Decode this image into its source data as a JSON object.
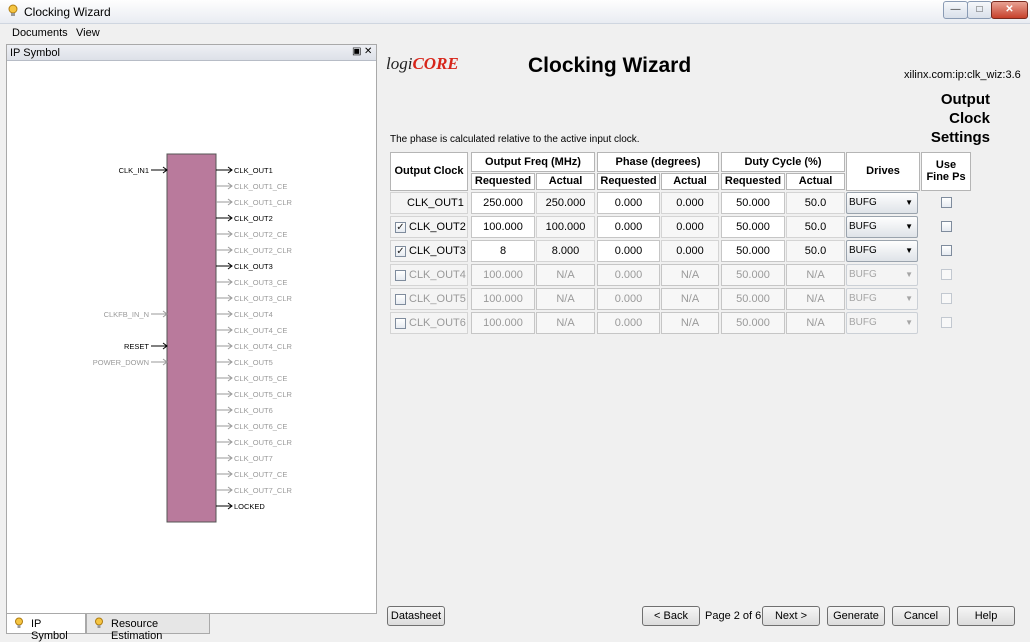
{
  "window": {
    "title": "Clocking Wizard",
    "controls": {
      "minimize": "—",
      "maximize": "□",
      "close": "✕"
    }
  },
  "menu": {
    "items": [
      "Documents",
      "View"
    ]
  },
  "left_panel": {
    "title": "IP Symbol",
    "header_icons": {
      "float": "▣",
      "close": "✕"
    },
    "symbol": {
      "block_color": "#b97a9c",
      "inputs": [
        {
          "label": "CLK_IN1",
          "active": true
        },
        {
          "label": "CLKFB_IN_N",
          "active": false
        },
        {
          "label": "RESET",
          "active": true
        },
        {
          "label": "POWER_DOWN",
          "active": false
        }
      ],
      "outputs": [
        {
          "label": "CLK_OUT1",
          "active": true
        },
        {
          "label": "CLK_OUT1_CE",
          "active": false
        },
        {
          "label": "CLK_OUT1_CLR",
          "active": false
        },
        {
          "label": "CLK_OUT2",
          "active": true
        },
        {
          "label": "CLK_OUT2_CE",
          "active": false
        },
        {
          "label": "CLK_OUT2_CLR",
          "active": false
        },
        {
          "label": "CLK_OUT3",
          "active": true
        },
        {
          "label": "CLK_OUT3_CE",
          "active": false
        },
        {
          "label": "CLK_OUT3_CLR",
          "active": false
        },
        {
          "label": "CLK_OUT4",
          "active": false
        },
        {
          "label": "CLK_OUT4_CE",
          "active": false
        },
        {
          "label": "CLK_OUT4_CLR",
          "active": false
        },
        {
          "label": "CLK_OUT5",
          "active": false
        },
        {
          "label": "CLK_OUT5_CE",
          "active": false
        },
        {
          "label": "CLK_OUT5_CLR",
          "active": false
        },
        {
          "label": "CLK_OUT6",
          "active": false
        },
        {
          "label": "CLK_OUT6_CE",
          "active": false
        },
        {
          "label": "CLK_OUT6_CLR",
          "active": false
        },
        {
          "label": "CLK_OUT7",
          "active": false
        },
        {
          "label": "CLK_OUT7_CE",
          "active": false
        },
        {
          "label": "CLK_OUT7_CLR",
          "active": false
        },
        {
          "label": "LOCKED",
          "active": true
        }
      ]
    },
    "tabs": [
      {
        "label": "IP Symbol",
        "active": true
      },
      {
        "label": "Resource Estimation",
        "active": false
      }
    ]
  },
  "main": {
    "logo": {
      "part1": "logi",
      "part2": "CORE"
    },
    "title": "Clocking Wizard",
    "ip_name": "xilinx.com:ip:clk_wiz:3.6",
    "page_heading": [
      "Output",
      "Clock",
      "Settings"
    ],
    "phase_note": "The phase is calculated relative to the active input clock.",
    "table": {
      "headers": {
        "output_clock": "Output Clock",
        "output_freq": "Output Freq (MHz)",
        "phase": "Phase (degrees)",
        "duty_cycle": "Duty Cycle (%)",
        "drives": "Drives",
        "use_fine_ps": [
          "Use",
          "Fine Ps"
        ],
        "requested": "Requested",
        "actual": "Actual"
      },
      "rows": [
        {
          "name": "CLK_OUT1",
          "has_checkbox": false,
          "checked": true,
          "enabled": true,
          "freq_req": "250.000",
          "freq_act": "250.000",
          "phase_req": "0.000",
          "phase_act": "0.000",
          "duty_req": "50.000",
          "duty_act": "50.0",
          "drives": "BUFG",
          "fine_ps": false
        },
        {
          "name": "CLK_OUT2",
          "has_checkbox": true,
          "checked": true,
          "enabled": true,
          "freq_req": "100.000",
          "freq_act": "100.000",
          "phase_req": "0.000",
          "phase_act": "0.000",
          "duty_req": "50.000",
          "duty_act": "50.0",
          "drives": "BUFG",
          "fine_ps": false
        },
        {
          "name": "CLK_OUT3",
          "has_checkbox": true,
          "checked": true,
          "enabled": true,
          "freq_req": "8",
          "freq_act": "8.000",
          "phase_req": "0.000",
          "phase_act": "0.000",
          "duty_req": "50.000",
          "duty_act": "50.0",
          "drives": "BUFG",
          "fine_ps": false
        },
        {
          "name": "CLK_OUT4",
          "has_checkbox": true,
          "checked": false,
          "enabled": false,
          "freq_req": "100.000",
          "freq_act": "N/A",
          "phase_req": "0.000",
          "phase_act": "N/A",
          "duty_req": "50.000",
          "duty_act": "N/A",
          "drives": "BUFG",
          "fine_ps": false
        },
        {
          "name": "CLK_OUT5",
          "has_checkbox": true,
          "checked": false,
          "enabled": false,
          "freq_req": "100.000",
          "freq_act": "N/A",
          "phase_req": "0.000",
          "phase_act": "N/A",
          "duty_req": "50.000",
          "duty_act": "N/A",
          "drives": "BUFG",
          "fine_ps": false
        },
        {
          "name": "CLK_OUT6",
          "has_checkbox": true,
          "checked": false,
          "enabled": false,
          "freq_req": "100.000",
          "freq_act": "N/A",
          "phase_req": "0.000",
          "phase_act": "N/A",
          "duty_req": "50.000",
          "duty_act": "N/A",
          "drives": "BUFG",
          "fine_ps": false
        }
      ]
    },
    "buttons": {
      "datasheet": "Datasheet",
      "back": "< Back",
      "page_info": "Page 2 of 6",
      "next": "Next >",
      "generate": "Generate",
      "cancel": "Cancel",
      "help": "Help"
    }
  }
}
